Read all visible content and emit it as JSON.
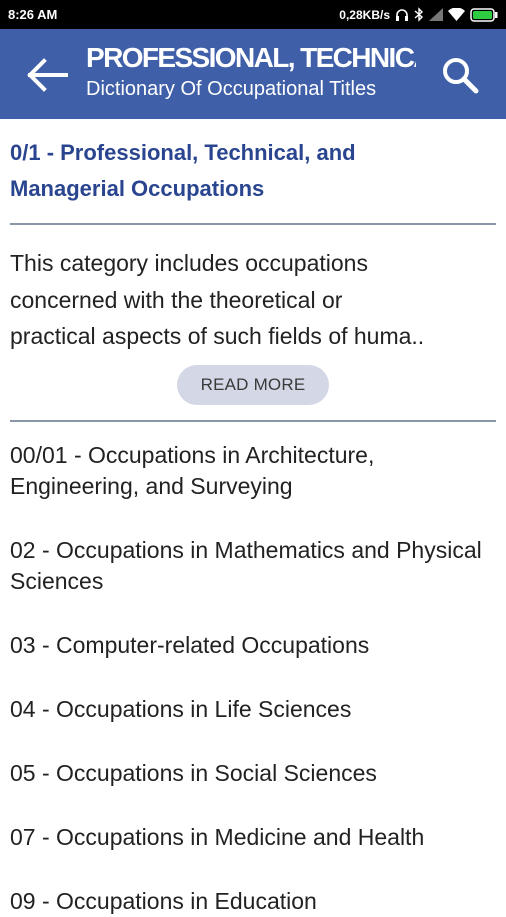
{
  "status_bar": {
    "time": "8:26 AM",
    "network_speed": "0,28KB/s",
    "icons": [
      "headset-icon",
      "bluetooth-icon",
      "signal-icon",
      "wifi-icon",
      "battery-icon"
    ]
  },
  "app_bar": {
    "title": "PROFESSIONAL, TECHNICAL",
    "subtitle": "Dictionary Of Occupational Titles",
    "back_icon": "arrow-left-icon",
    "search_icon": "search-icon",
    "color": "#3f5fa8"
  },
  "category": {
    "heading": "0/1 - Professional, Technical, and Managerial Occupations",
    "description_lines": [
      "This category includes occupations",
      "concerned with the theoretical or",
      "practical aspects of such fields of huma.."
    ],
    "read_more_label": "READ MORE",
    "accent_color": "#2a4590"
  },
  "occupations": [
    {
      "label": "00/01 - Occupations in Architecture, Engineering, and Surveying"
    },
    {
      "label": "02 - Occupations in Mathematics and Physical Sciences"
    },
    {
      "label": "03 - Computer-related Occupations"
    },
    {
      "label": "04 - Occupations in Life Sciences"
    },
    {
      "label": "05 - Occupations in Social Sciences"
    },
    {
      "label": "07 - Occupations in Medicine and Health"
    },
    {
      "label": "09 - Occupations in Education"
    }
  ]
}
